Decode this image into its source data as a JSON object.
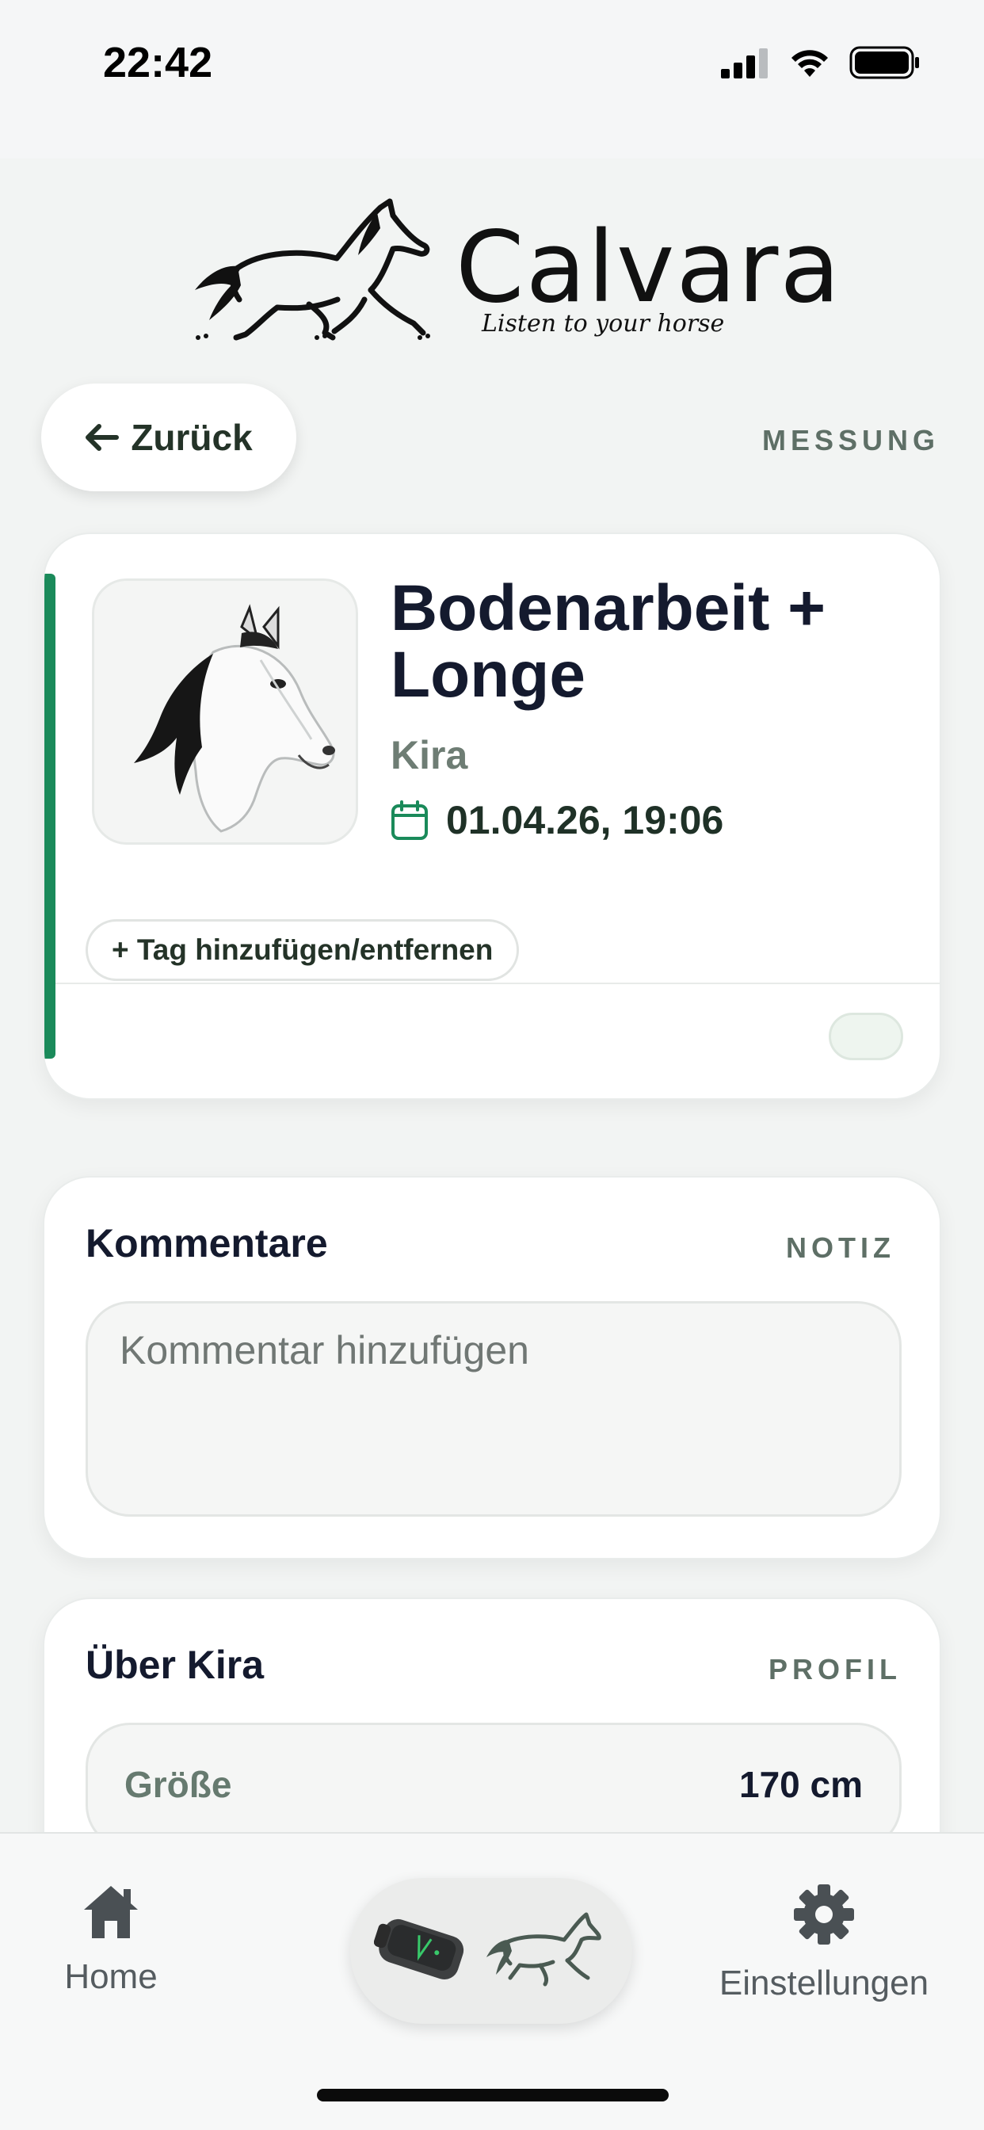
{
  "status_bar": {
    "time": "22:42"
  },
  "logo": {
    "wordmark": "Calvara",
    "tagline": "Listen to your horse"
  },
  "nav": {
    "back_label": "Zurück",
    "section_label": "MESSUNG"
  },
  "session": {
    "title": "Bodenarbeit + Longe",
    "horse_name": "Kira",
    "datetime": "01.04.26, 19:06",
    "tag_button_label": "+ Tag hinzufügen/entfernen",
    "accent_color": "#1a8a5a"
  },
  "comments": {
    "title": "Kommentare",
    "tag": "NOTIZ",
    "placeholder": "Kommentar hinzufügen",
    "value": ""
  },
  "profile": {
    "title": "Über Kira",
    "tag": "PROFIL",
    "rows": [
      {
        "label": "Größe",
        "value": "170 cm"
      }
    ]
  },
  "tab_bar": {
    "home_label": "Home",
    "settings_label": "Einstellungen",
    "home_icon": "house-icon",
    "settings_icon": "gear-icon",
    "center_icon": "sensor-and-horse-icon"
  }
}
